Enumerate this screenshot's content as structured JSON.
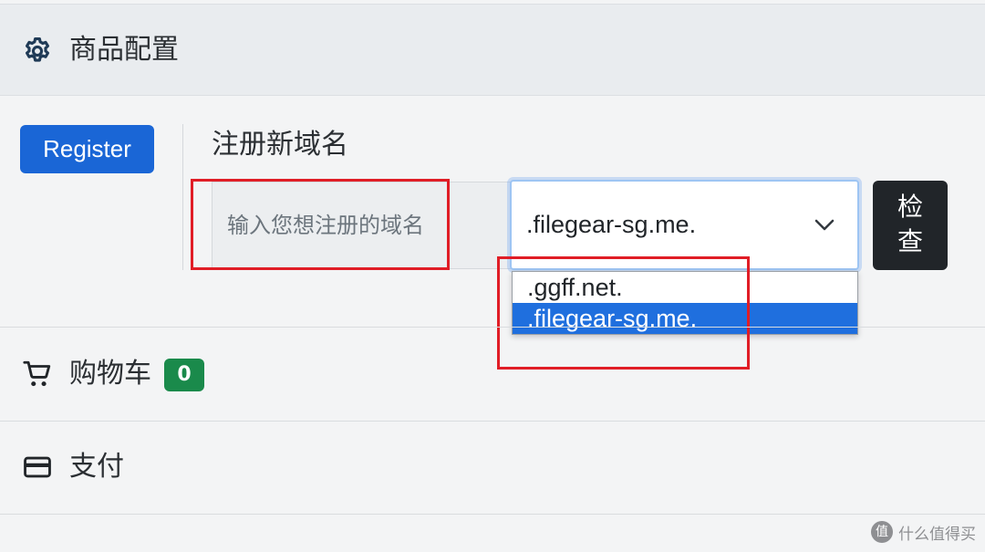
{
  "header": {
    "title": "商品配置",
    "icon": "gear-icon"
  },
  "register": {
    "button_label": "Register",
    "section_title": "注册新域名",
    "input_placeholder": "输入您想注册的域名",
    "selected_tld": ".filegear-sg.me.",
    "check_label_line1": "检",
    "check_label_line2": "查",
    "tld_options": [
      ".ggff.net.",
      ".filegear-sg.me."
    ],
    "highlighted_option": ".filegear-sg.me."
  },
  "cart": {
    "label": "购物车",
    "count": "0",
    "icon": "cart-icon",
    "badge_color": "#1a8a4b"
  },
  "payment": {
    "label": "支付",
    "icon": "credit-card-icon"
  },
  "watermark": {
    "text": "什么值得买",
    "logo_text": "值"
  },
  "colors": {
    "primary": "#1a66d6",
    "highlight": "#1f6fde",
    "annotation": "#e01d26",
    "dark_button": "#212529"
  }
}
